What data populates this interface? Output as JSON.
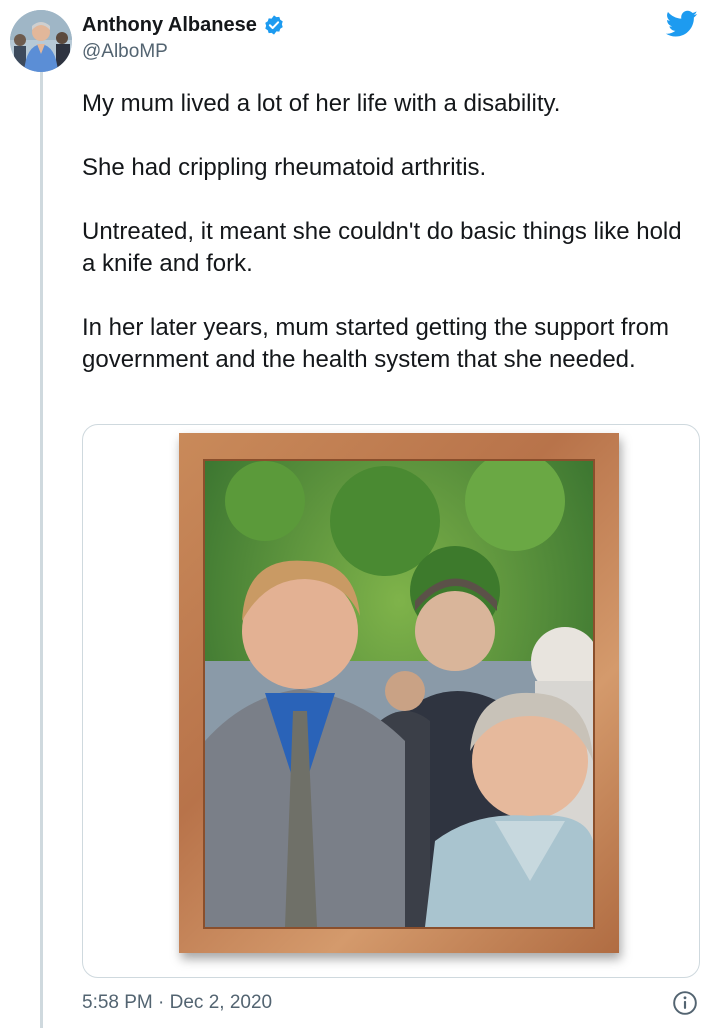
{
  "tweet": {
    "author": {
      "name": "Anthony Albanese",
      "handle": "@AlboMP",
      "verified": true
    },
    "paragraphs": [
      "My mum lived a lot of her life with a disability.",
      "She had crippling rheumatoid arthritis.",
      "Untreated, it meant she couldn't do basic things like hold a knife and fork.",
      "In her later years, mum started getting the support from government and the health system that she needed."
    ],
    "timestamp": "5:58 PM · Dec 2, 2020"
  },
  "icons": {
    "verified": "verified-badge-icon",
    "brand": "twitter-bird-icon",
    "info": "info-icon"
  },
  "colors": {
    "brand_blue": "#1d9bf0",
    "text_primary": "#14171a",
    "text_secondary": "#536471",
    "border": "#cfd9de"
  }
}
